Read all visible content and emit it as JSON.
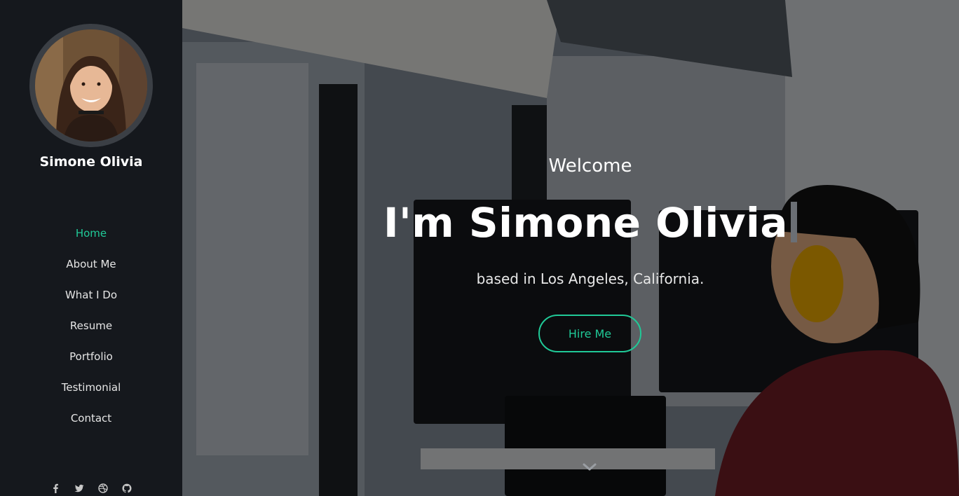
{
  "sidebar": {
    "profile_name": "Simone Olivia",
    "nav": [
      {
        "label": "Home",
        "active": true
      },
      {
        "label": "About Me",
        "active": false
      },
      {
        "label": "What I Do",
        "active": false
      },
      {
        "label": "Resume",
        "active": false
      },
      {
        "label": "Portfolio",
        "active": false
      },
      {
        "label": "Testimonial",
        "active": false
      },
      {
        "label": "Contact",
        "active": false
      }
    ],
    "social_icons": [
      "facebook-icon",
      "twitter-icon",
      "dribbble-icon",
      "github-icon"
    ]
  },
  "hero": {
    "welcome": "Welcome",
    "headline": "I'm Simone Olivia",
    "subtitle": "based in Los Angeles, California.",
    "cta_label": "Hire Me",
    "scroll_icon": "chevron-down-icon"
  },
  "colors": {
    "accent": "#20c997",
    "sidebar_bg": "#15181d",
    "text": "#ffffff"
  }
}
